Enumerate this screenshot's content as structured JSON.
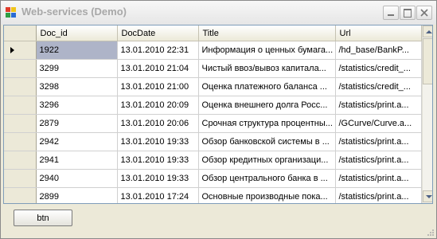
{
  "window": {
    "title": "Web-services (Demo)"
  },
  "grid": {
    "columns": [
      "Doc_id",
      "DocDate",
      "Title",
      "Url"
    ],
    "rows": [
      [
        "1922",
        "13.01.2010 22:31",
        "Информация о ценных бумага...",
        "/hd_base/BankP..."
      ],
      [
        "3299",
        "13.01.2010 21:04",
        "Чистый ввоз/вывоз капитала...",
        "/statistics/credit_..."
      ],
      [
        "3298",
        "13.01.2010 21:00",
        "Оценка платежного баланса ...",
        "/statistics/credit_..."
      ],
      [
        "3296",
        "13.01.2010 20:09",
        "Оценка внешнего долга Росс...",
        "/statistics/print.a..."
      ],
      [
        "2879",
        "13.01.2010 20:06",
        "Срочная структура процентны...",
        "/GCurve/Curve.a..."
      ],
      [
        "2942",
        "13.01.2010 19:33",
        "Обзор банковской системы в ...",
        "/statistics/print.a..."
      ],
      [
        "2941",
        "13.01.2010 19:33",
        "Обзор кредитных организаци...",
        "/statistics/print.a..."
      ],
      [
        "2940",
        "13.01.2010 19:33",
        "Обзор центрального банка в ...",
        "/statistics/print.a..."
      ],
      [
        "2899",
        "13.01.2010 17:24",
        "Основные производные пока...",
        "/statistics/print.a..."
      ]
    ],
    "selected_row": 0
  },
  "button": {
    "label": "btn"
  },
  "colors": {
    "header_bg": "#ece9d8",
    "selection": "#aeb4c8",
    "grid_border": "#7f9db9"
  },
  "icons": {
    "app": "app-icon",
    "minimize": "minimize-icon",
    "maximize": "maximize-icon",
    "close": "close-icon",
    "row_pointer": "row-pointer-icon"
  }
}
